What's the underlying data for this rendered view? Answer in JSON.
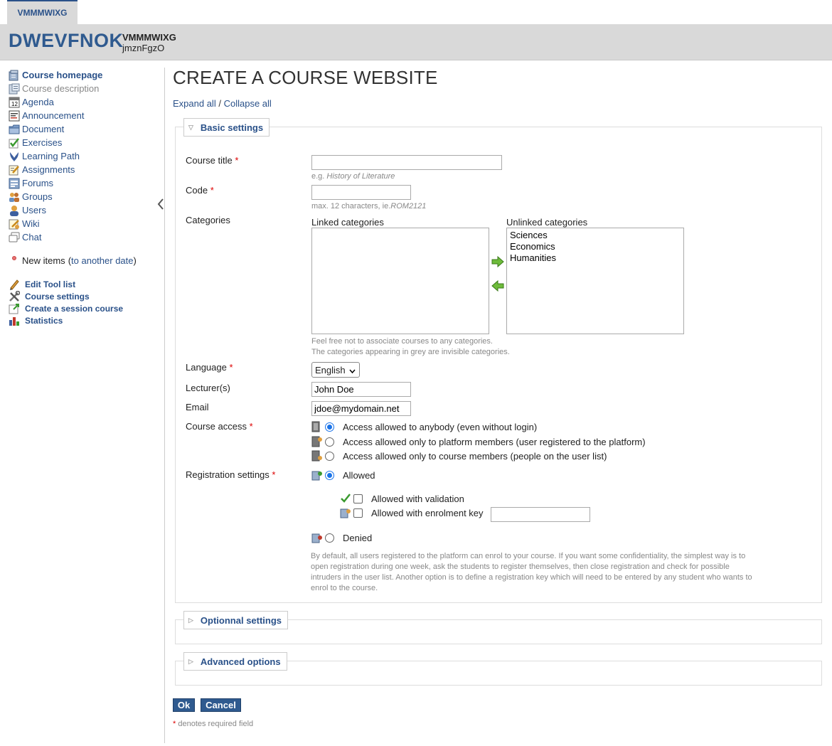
{
  "top_tab": {
    "label": "VMMMWIXG"
  },
  "header": {
    "campus_title": "DWEVFNOK",
    "course_code": "VMMMWIXG",
    "course_user": "jmznFgzO"
  },
  "sidebar": {
    "tools": [
      {
        "label": "Course homepage",
        "icon": "home-icon"
      },
      {
        "label": "Course description",
        "icon": "description-icon"
      },
      {
        "label": "Agenda",
        "icon": "calendar-icon"
      },
      {
        "label": "Announcement",
        "icon": "announcement-icon"
      },
      {
        "label": "Document",
        "icon": "folder-icon"
      },
      {
        "label": "Exercises",
        "icon": "check-icon"
      },
      {
        "label": "Learning Path",
        "icon": "learning-path-icon"
      },
      {
        "label": "Assignments",
        "icon": "assignment-icon"
      },
      {
        "label": "Forums",
        "icon": "forum-icon"
      },
      {
        "label": "Groups",
        "icon": "groups-icon"
      },
      {
        "label": "Users",
        "icon": "user-icon"
      },
      {
        "label": "Wiki",
        "icon": "wiki-icon"
      },
      {
        "label": "Chat",
        "icon": "chat-icon"
      }
    ],
    "new_items": {
      "label": "New items",
      "link_open": "(",
      "link": "to another date",
      "link_close": ")"
    },
    "admin": [
      {
        "label": "Edit Tool list",
        "icon": "pencil-icon"
      },
      {
        "label": "Course settings",
        "icon": "tools-icon"
      },
      {
        "label": "Create a session course",
        "icon": "session-icon"
      },
      {
        "label": "Statistics",
        "icon": "statistics-icon"
      }
    ]
  },
  "main": {
    "title": "CREATE A COURSE WEBSITE",
    "expand_all": "Expand all",
    "separator": "/",
    "collapse_all": "Collapse all",
    "basic_settings": {
      "legend": "Basic settings",
      "course_title": {
        "label": "Course title",
        "value": "",
        "hint_prefix": "e.g.",
        "hint_example": "History of Literature"
      },
      "code": {
        "label": "Code",
        "value": "",
        "hint_prefix": "max. 12 characters, ie.",
        "hint_example": "ROM2121"
      },
      "categories": {
        "label": "Categories",
        "linked_title": "Linked categories",
        "linked": [],
        "unlinked_title": "Unlinked categories",
        "unlinked": [
          "Sciences",
          "Economics",
          "Humanities"
        ],
        "hint1": "Feel free not to associate courses to any categories.",
        "hint2": "The categories appearing in grey are invisible categories."
      },
      "language": {
        "label": "Language",
        "value": "English"
      },
      "lecturers": {
        "label": "Lecturer(s)",
        "value": "John Doe"
      },
      "email": {
        "label": "Email",
        "value": "jdoe@mydomain.net"
      },
      "course_access": {
        "label": "Course access",
        "options": [
          "Access allowed to anybody (even without login)",
          "Access allowed only to platform members (user registered to the platform)",
          "Access allowed only to course members (people on the user list)"
        ],
        "selected": 0
      },
      "registration": {
        "label": "Registration settings",
        "allowed": "Allowed",
        "with_validation": "Allowed with validation",
        "with_key": "Allowed with enrolment key",
        "key_value": "",
        "denied": "Denied",
        "help": "By default, all users registered to the platform can enrol to your course. If you want some confidentiality, the simplest way is to open registration during one week, ask the students to register themselves, then close registration and check for possible intruders in the user list. Another option is to define a registration key which will need to be entered by any student who wants to enrol to the course."
      }
    },
    "optional_settings": {
      "legend": "Optionnal settings"
    },
    "advanced_options": {
      "legend": "Advanced options"
    },
    "ok_label": "Ok",
    "cancel_label": "Cancel",
    "required_star": "*",
    "required_note": "denotes required field"
  },
  "colors": {
    "accent": "#2f5a8f",
    "link": "#2a5189",
    "required": "#dd0000",
    "header_bg": "#d9d9d9"
  }
}
